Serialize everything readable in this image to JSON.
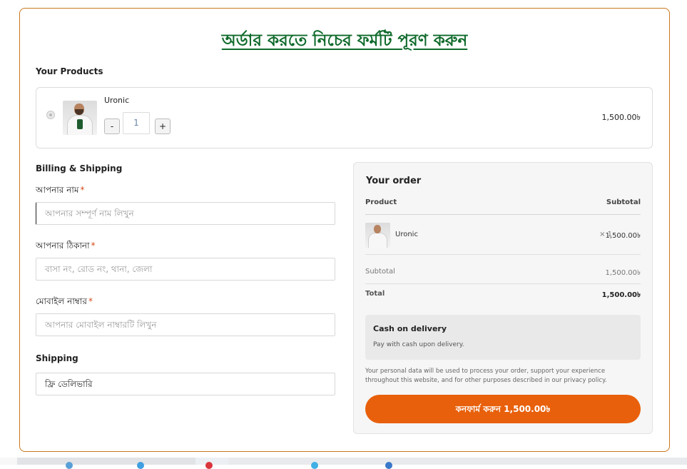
{
  "page": {
    "title": "অর্ডার করতে নিচের ফর্মটি পূরণ করুন"
  },
  "products": {
    "heading": "Your Products",
    "items": [
      {
        "name": "Uronic",
        "quantity": "1",
        "minus_label": "-",
        "plus_label": "+",
        "price": "1,500.00৳"
      }
    ]
  },
  "billing": {
    "heading": "Billing & Shipping",
    "fields": [
      {
        "label": "আপনার নাম",
        "required_mark": "*",
        "placeholder": "আপনার সম্পূর্ণ নাম লিখুন"
      },
      {
        "label": "আপনার ঠিকানা",
        "required_mark": "*",
        "placeholder": "বাসা নং, রোড নং, থানা, জেলা"
      },
      {
        "label": "মোবাইল নাম্বার",
        "required_mark": "*",
        "placeholder": "আপনার মোবাইল নাম্বারটি লিখুন"
      }
    ],
    "shipping_heading": "Shipping",
    "shipping_value": "ফ্রি ডেলিভারি"
  },
  "order": {
    "heading": "Your order",
    "col_product": "Product",
    "col_subtotal": "Subtotal",
    "line": {
      "name": "Uronic",
      "qty": "× 1",
      "amount": "1,500.00৳"
    },
    "subtotal_label": "Subtotal",
    "subtotal_value": "1,500.00৳",
    "total_label": "Total",
    "total_value": "1,500.00৳",
    "payment_title": "Cash on delivery",
    "payment_desc": "Pay with cash upon delivery.",
    "privacy_note": "Your personal data will be used to process your order, support your experience throughout this website, and for other purposes described in our privacy policy.",
    "confirm_label": "কনফার্ম করুন 1,500.00৳"
  },
  "colors": {
    "accent": "#e8600b",
    "title_green": "#0f6a2b",
    "frame_border": "#c9761c",
    "required": "#d54b1a"
  }
}
